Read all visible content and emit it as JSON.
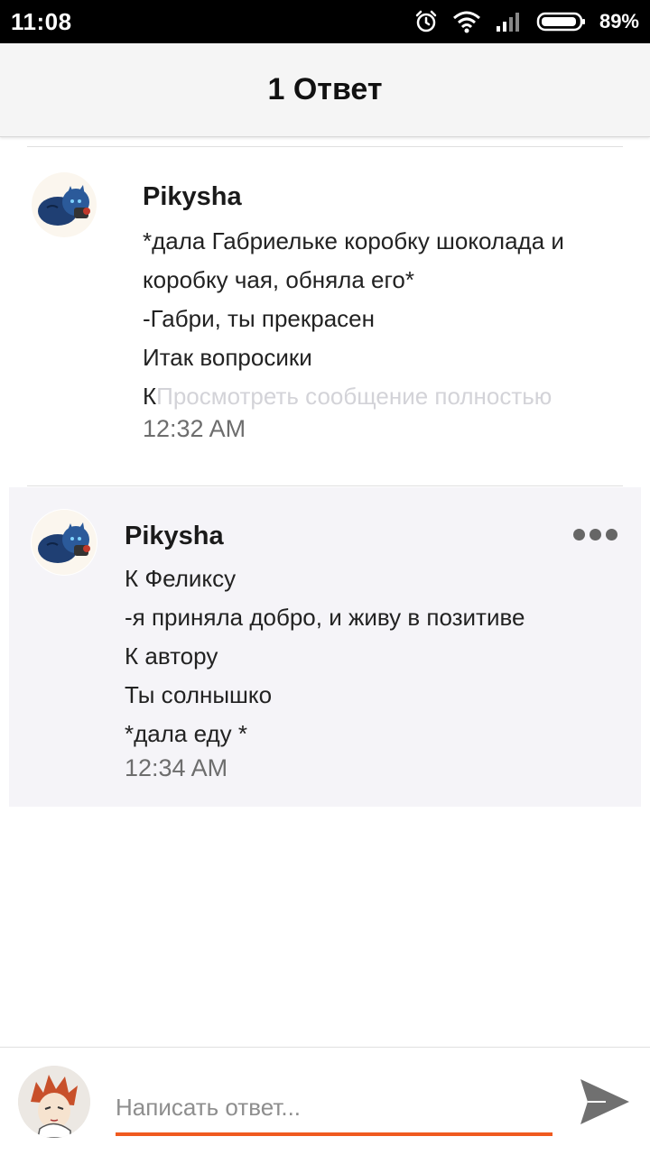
{
  "status_bar": {
    "time": "11:08",
    "battery_percent": "89%",
    "icons": [
      "alarm-icon",
      "wifi-icon",
      "signal-icon",
      "battery-icon"
    ]
  },
  "header": {
    "title": "1 Ответ"
  },
  "messages": [
    {
      "author": "Pikysha",
      "lines": [
        "*дала Габриельке коробку шоколада и",
        "коробку чая, обняла его*",
        "-Габри, ты прекрасен",
        "Итак вопросики"
      ],
      "last_line_start": "К",
      "more_link": "Просмотреть сообщение полностью",
      "time": "12:32 AM"
    },
    {
      "author": "Pikysha",
      "lines": [
        "К Феликсу",
        "-я приняла добро, и живу в позитиве",
        "К автору",
        "Ты солнышко",
        "*дала еду *"
      ],
      "time": "12:34 AM"
    }
  ],
  "composer": {
    "placeholder": "Написать ответ...",
    "accent_color": "#f05a1f"
  },
  "colors": {
    "status_bar": "#000000",
    "header_bg": "#f5f5f5",
    "highlight_bg": "#f5f4f8",
    "muted_link": "#d3d3d8",
    "timestamp": "#6d6d6d"
  }
}
